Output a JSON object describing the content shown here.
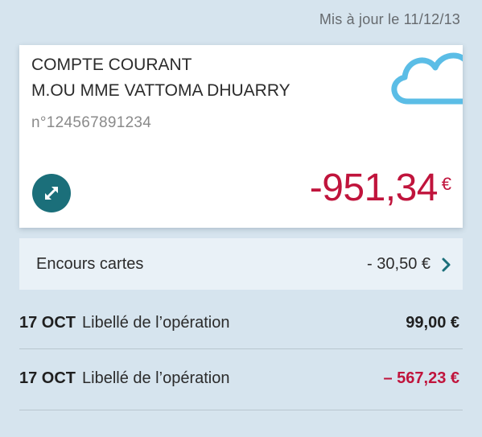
{
  "updated_label": "Mis à jour le 11/12/13",
  "account": {
    "type": "COMPTE COURANT",
    "owner": "M.OU MME VATTOMA DHUARRY",
    "number": "n°124567891234",
    "balance": "-951,34",
    "currency": "€",
    "weather_icon": "cloud-icon",
    "transfer_icon": "transfer-arrows-icon"
  },
  "encours": {
    "label": "Encours cartes",
    "amount": "- 30,50 €"
  },
  "operations": [
    {
      "date": "17 OCT",
      "label": "Libellé de l’opération",
      "amount": "99,00 €",
      "color": "#1f1f1f"
    },
    {
      "date": "17 OCT",
      "label": "Libellé de l’opération",
      "amount": "– 567,23 €",
      "color": "#c0143c"
    }
  ],
  "colors": {
    "background": "#d6e4ee",
    "negative": "#c0143c",
    "accent": "#1b6f7a",
    "cloud": "#5bbde6"
  }
}
